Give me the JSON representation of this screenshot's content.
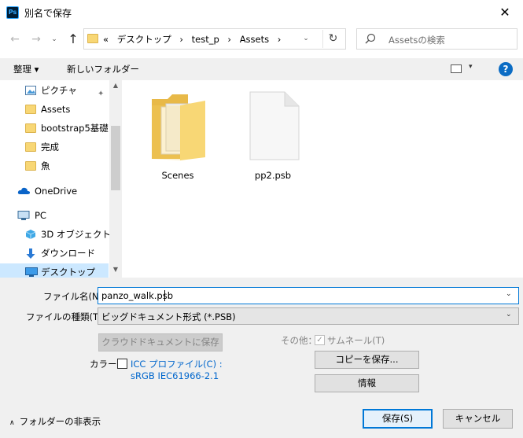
{
  "window": {
    "app_icon": "Ps",
    "title": "別名で保存",
    "close": "✕"
  },
  "nav": {
    "back": "←",
    "forward": "→",
    "recent": "⌄",
    "up": "↑",
    "breadcrumbs": [
      "«",
      "デスクトップ",
      "›",
      "test_p",
      "›",
      "Assets",
      "›"
    ],
    "dropdown": "⌄",
    "refresh": "↻",
    "search_placeholder": "Assetsの検索"
  },
  "toolbar": {
    "organize": "整理 ▾",
    "new_folder": "新しいフォルダー",
    "view_dd": "▾",
    "help": "?"
  },
  "sidebar": {
    "items": [
      {
        "label": "ピクチャ",
        "icon": "pictures-icon"
      },
      {
        "label": "Assets",
        "icon": "folder-icon"
      },
      {
        "label": "bootstrap5基礎",
        "icon": "folder-icon"
      },
      {
        "label": "完成",
        "icon": "folder-icon"
      },
      {
        "label": "魚",
        "icon": "folder-icon"
      },
      {
        "label": "OneDrive",
        "icon": "onedrive-icon"
      },
      {
        "label": "PC",
        "icon": "pc-icon"
      },
      {
        "label": "3D オブジェクト",
        "icon": "3d-objects-icon"
      },
      {
        "label": "ダウンロード",
        "icon": "download-icon"
      },
      {
        "label": "デスクトップ",
        "icon": "desktop-icon"
      }
    ],
    "pin": "📌"
  },
  "files": [
    {
      "name": "Scenes",
      "type": "folder"
    },
    {
      "name": "pp2.psb",
      "type": "file"
    }
  ],
  "form": {
    "filename_label": "ファイル名(N):",
    "filename_value": "panzo_walk.psb",
    "filetype_label": "ファイルの種類(T):",
    "filetype_value": "ビッグドキュメント形式 (*.PSB)",
    "cloud_save": "クラウドドキュメントに保存",
    "other_label": "その他：",
    "thumbnail_label": "サムネール(T)",
    "thumbnail_checked": true,
    "check_mark": "✓",
    "color_label": "カラー：",
    "icc_line1": "ICC プロファイル(C) :",
    "icc_line2": "sRGB IEC61966-2.1",
    "save_copy": "コピーを保存...",
    "info": "情報",
    "dd": "⌄"
  },
  "footer": {
    "hide_folders_chev": "∧",
    "hide_folders": "フォルダーの非表示",
    "save": "保存(S)",
    "cancel": "キャンセル"
  }
}
